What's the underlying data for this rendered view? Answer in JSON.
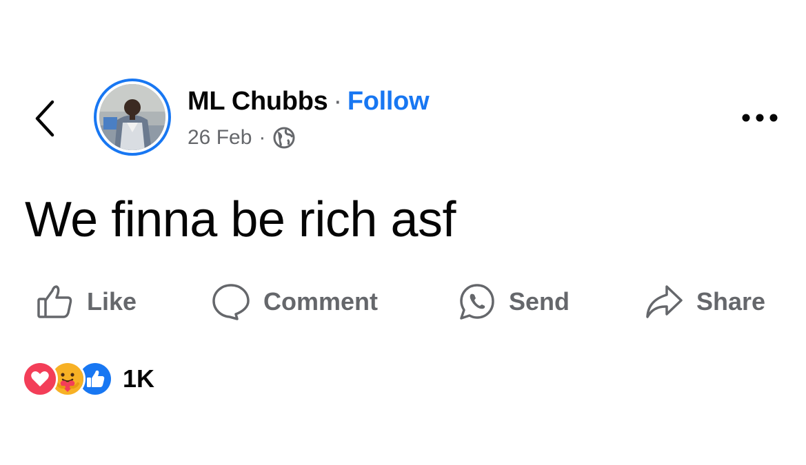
{
  "post": {
    "author": "ML Chubbs",
    "separator": "·",
    "follow_label": "Follow",
    "date": "26 Feb",
    "meta_separator": "·",
    "text": "We finna be rich asf"
  },
  "actions": {
    "like_label": "Like",
    "comment_label": "Comment",
    "send_label": "Send",
    "share_label": "Share"
  },
  "reactions": {
    "types": [
      "love-icon",
      "care-icon",
      "like-icon"
    ],
    "count": "1K"
  },
  "icons": {
    "back": "chevron-left-icon",
    "privacy": "globe-icon",
    "more": "more-options-icon"
  },
  "colors": {
    "accent": "#1877f2",
    "secondary_text": "#65676b",
    "primary_text": "#050505",
    "love_reaction": "#f33e58",
    "care_reaction": "#f7b125",
    "like_reaction": "#1877f2"
  }
}
